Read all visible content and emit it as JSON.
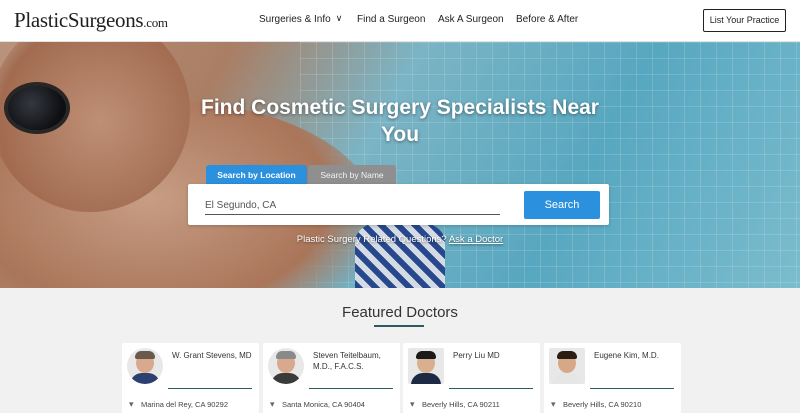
{
  "header": {
    "logo_main": "PlasticSurgeons",
    "logo_tld": ".com",
    "nav": [
      {
        "label": "Surgeries & Info",
        "icon": "chevron-down-icon"
      },
      {
        "label": "Find a Surgeon"
      },
      {
        "label": "Ask A Surgeon"
      },
      {
        "label": "Before & After"
      }
    ],
    "cta_label": "List Your Practice"
  },
  "hero": {
    "title": "Find Cosmetic Surgery Specialists Near You",
    "tabs": [
      "Search by Location",
      "Search by Name"
    ],
    "search_value": "El Segundo, CA",
    "search_button": "Search",
    "question_text": "Plastic Surgery Related Questions?",
    "question_link": "Ask a Doctor",
    "accent_color": "#2b90dd"
  },
  "featured": {
    "title": "Featured Doctors",
    "doctors": [
      {
        "name": "W. Grant Stevens, MD",
        "location": "Marina del Rey, CA 90292"
      },
      {
        "name": "Steven Teitelbaum, M.D., F.A.C.S.",
        "location": "Santa Monica, CA 90404"
      },
      {
        "name": "Perry Liu MD",
        "location": "Beverly Hills, CA 90211"
      },
      {
        "name": "Eugene Kim, M.D.",
        "location": "Beverly Hills, CA 90210"
      }
    ],
    "location_icon": "map-pin-icon"
  }
}
